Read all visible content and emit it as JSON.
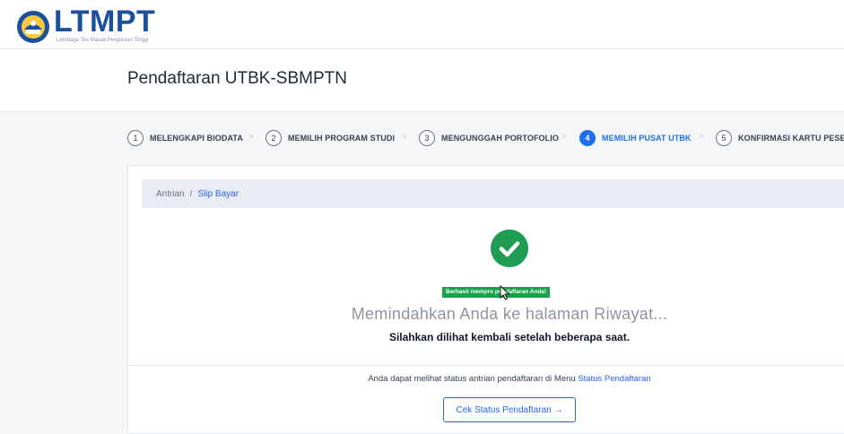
{
  "brand": {
    "logo_text": "LTMPT",
    "logo_subtitle": "Lembaga Tes Masuk Perguruan Tinggi"
  },
  "page": {
    "title": "Pendaftaran UTBK-SBMPTN"
  },
  "stepper": {
    "steps": [
      {
        "number": "1",
        "label": "MELENGKAPI BIODATA",
        "active": false
      },
      {
        "number": "2",
        "label": "MEMILIH PROGRAM STUDI",
        "active": false
      },
      {
        "number": "3",
        "label": "MENGUNGGAH PORTOFOLIO",
        "active": false
      },
      {
        "number": "4",
        "label": "MEMILIH PUSAT UTBK",
        "active": true
      },
      {
        "number": "5",
        "label": "KONFIRMASI KARTU PESERT",
        "active": false
      }
    ],
    "separator": ">"
  },
  "breadcrumb": {
    "items": [
      "Antrian",
      "Slip Bayar"
    ],
    "separator": "/"
  },
  "result": {
    "icon": "check-circle-icon",
    "toast_text": "Berhasil mempro     pendaftaran Anda!",
    "main_message": "Memindahkan Anda ke halaman Riwayat...",
    "sub_message": "Silahkan dilihat kembali setelah beberapa saat."
  },
  "footer": {
    "status_text": "Anda dapat melihat status antrian pendaftaran di Menu",
    "status_link": "Status Pendaftaran",
    "button_label": "Cek Status Pendaftaran →"
  },
  "colors": {
    "brand": "#1c4f9c",
    "accent": "#1f6feb",
    "success": "#1f9d55"
  }
}
